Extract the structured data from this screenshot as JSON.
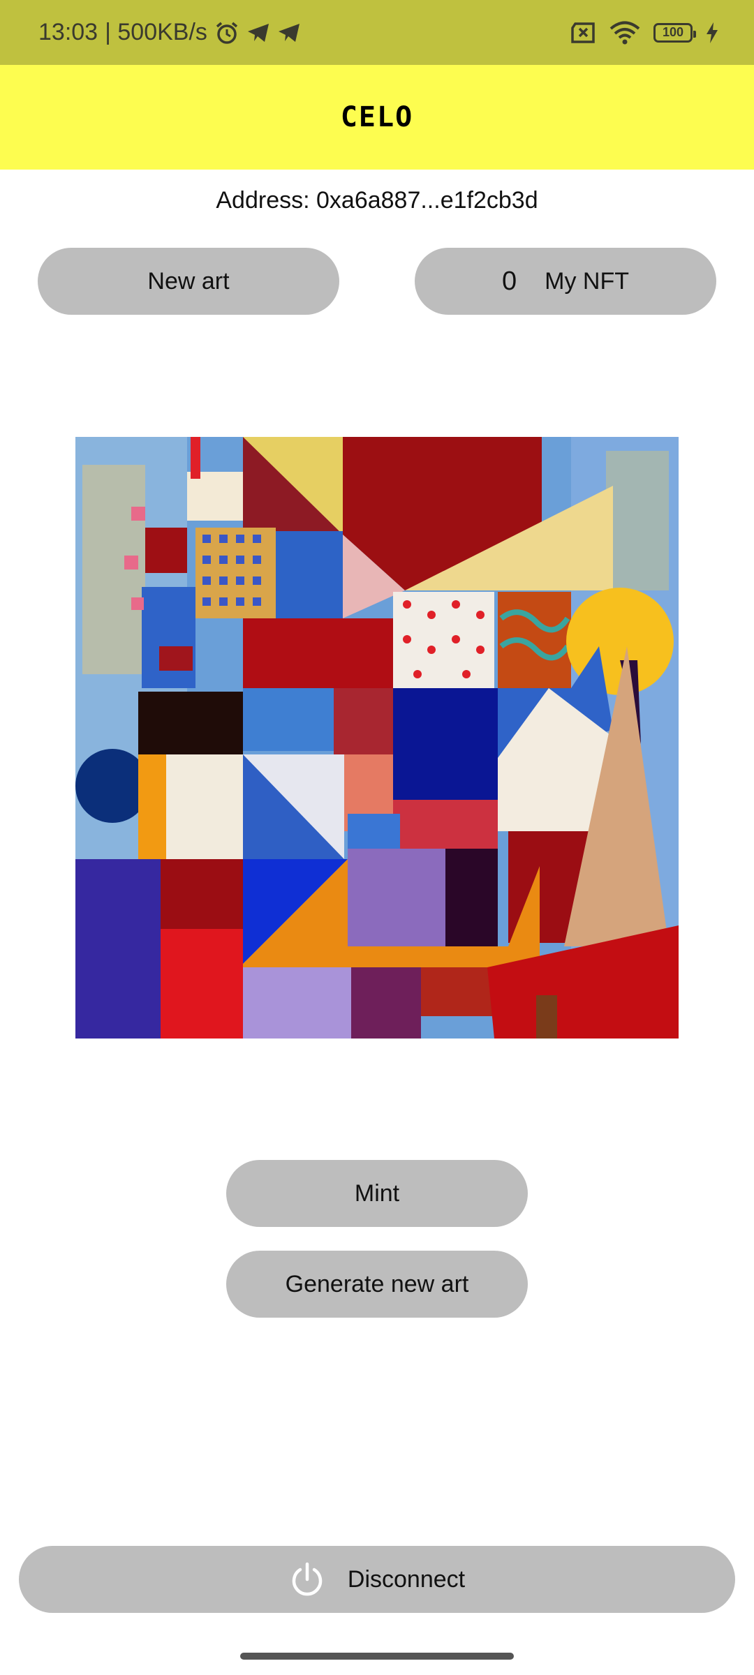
{
  "status_bar": {
    "time": "13:03",
    "network_speed": "| 500KB/s",
    "battery_level": "100",
    "icons": [
      "alarm-icon",
      "telegram-icon",
      "telegram-icon",
      "no-sim-icon",
      "wifi-icon",
      "battery-icon",
      "charging-icon"
    ]
  },
  "header": {
    "logo": "CELO",
    "background": "#fdfd50"
  },
  "address": {
    "text": "Address: 0xa6a887...e1f2cb3d"
  },
  "buttons": {
    "new_art": "New art",
    "my_nft_count": "0",
    "my_nft": "My NFT",
    "mint": "Mint",
    "generate": "Generate new art",
    "disconnect": "Disconnect"
  },
  "colors": {
    "status_bar": "#bfc13f",
    "button": "#bdbdbd"
  }
}
